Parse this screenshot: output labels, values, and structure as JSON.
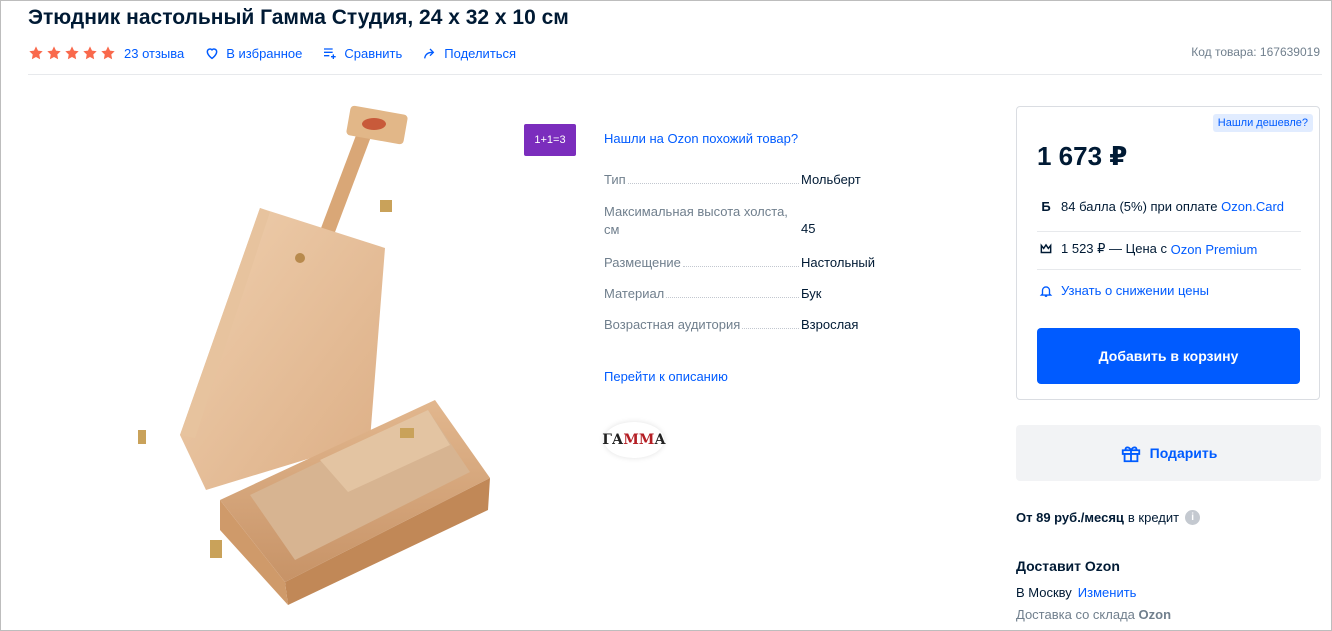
{
  "product": {
    "title": "Этюдник настольный Гамма Студия, 24 x 32 x 10 см",
    "rating_stars": 5,
    "reviews": "23 отзыва",
    "favorite": "В избранное",
    "compare": "Сравнить",
    "share": "Поделиться",
    "sku": "Код товара: 167639019"
  },
  "promo": {
    "badge": "1+1=3",
    "similar_link": "Нашли на Ozon похожий товар?"
  },
  "specs": [
    {
      "name": "Тип",
      "value": "Мольберт"
    },
    {
      "name": "Максимальная высота холста, см",
      "value": "45"
    },
    {
      "name": "Размещение",
      "value": "Настольный"
    },
    {
      "name": "Материал",
      "value": "Бук"
    },
    {
      "name": "Возрастная аудитория",
      "value": "Взрослая"
    }
  ],
  "description_link": "Перейти к описанию",
  "brand": {
    "logo_text_a": "ГА",
    "logo_text_b": "ММ",
    "logo_text_c": "А"
  },
  "price_card": {
    "cheaper": "Нашли дешевле?",
    "price": "1 673 ₽",
    "points_icon": "Б",
    "points_text": "84 балла (5%) при оплате",
    "points_link": "Ozon.Card",
    "premium_text": "1 523 ₽ — Цена с",
    "premium_link": "Ozon Premium",
    "notify": "Узнать о снижении цены",
    "add_to_cart": "Добавить в корзину"
  },
  "gift_button": "Подарить",
  "credit": {
    "amount": "От 89 руб./месяц",
    "suffix": "в кредит",
    "info": "i"
  },
  "delivery": {
    "title": "Доставит Ozon",
    "city": "В Москву",
    "change": "Изменить",
    "stock_prefix": "Доставка со склада",
    "stock_name": "Ozon"
  },
  "colors": {
    "accent": "#005bff",
    "star": "#f9694c",
    "promo": "#7b2dbd"
  }
}
